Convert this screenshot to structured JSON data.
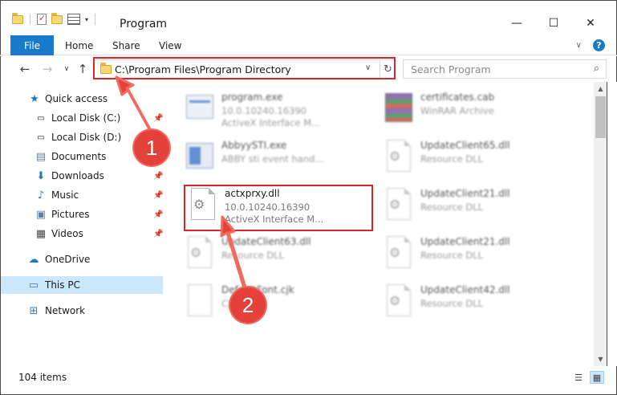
{
  "window": {
    "title": "Program",
    "minimize_glyph": "—",
    "maximize_glyph": "☐",
    "close_glyph": "✕"
  },
  "ribbon": {
    "file_tab": "File",
    "tabs": [
      "Home",
      "Share",
      "View"
    ],
    "help_glyph": "?"
  },
  "address": {
    "path": "C:\\Program Files\\Program Directory",
    "search_placeholder": "Search Program"
  },
  "navpane": {
    "items": [
      {
        "label": "Quick access",
        "icon": "star-icon",
        "pinned": false
      },
      {
        "label": "Local Disk (C:)",
        "icon": "drive-icon",
        "pinned": true
      },
      {
        "label": "Local Disk (D:)",
        "icon": "drive-icon",
        "pinned": true
      },
      {
        "label": "Documents",
        "icon": "documents-icon",
        "pinned": true
      },
      {
        "label": "Downloads",
        "icon": "download-icon",
        "pinned": true
      },
      {
        "label": "Music",
        "icon": "music-icon",
        "pinned": true
      },
      {
        "label": "Pictures",
        "icon": "pictures-icon",
        "pinned": true
      },
      {
        "label": "Videos",
        "icon": "videos-icon",
        "pinned": true
      },
      {
        "label": "OneDrive",
        "icon": "cloud-icon",
        "pinned": false
      },
      {
        "label": "This PC",
        "icon": "pc-icon",
        "pinned": false,
        "selected": true
      },
      {
        "label": "Network",
        "icon": "network-icon",
        "pinned": false
      }
    ]
  },
  "files": [
    {
      "name": "program.exe",
      "sub1": "10.0.10240.16390",
      "sub2": "ActiveX Interface M...",
      "icon": "exe-icon"
    },
    {
      "name": "certificates.cab",
      "sub1": "WinRAR Archive",
      "sub2": "",
      "icon": "archive-icon"
    },
    {
      "name": "AbbyySTI.exe",
      "sub1": "ABBY sti event hand...",
      "sub2": "",
      "icon": "app-icon"
    },
    {
      "name": "UpdateClient65.dll",
      "sub1": "Resource DLL",
      "sub2": "",
      "icon": "dll-icon"
    },
    {
      "name": "actxprxy.dll",
      "sub1": "10.0.10240.16390",
      "sub2": "ActiveX Interface M...",
      "icon": "dll-icon"
    },
    {
      "name": "UpdateClient21.dll",
      "sub1": "Resource DLL",
      "sub2": "",
      "icon": "dll-icon"
    },
    {
      "name": "UpdateClient63.dll",
      "sub1": "Resource DLL",
      "sub2": "",
      "icon": "dll-icon"
    },
    {
      "name": "UpdateClient21.dll",
      "sub1": "Resource DLL",
      "sub2": "",
      "icon": "dll-icon"
    },
    {
      "name": "DefaultFont.cjk",
      "sub1": "CJK File",
      "sub2": "",
      "icon": "document-icon"
    },
    {
      "name": "UpdateClient42.dll",
      "sub1": "Resource DLL",
      "sub2": "",
      "icon": "dll-icon"
    }
  ],
  "status": {
    "items_count": "104 items"
  },
  "callouts": {
    "step1": "1",
    "step2": "2"
  },
  "colors": {
    "accent": "#1979ca",
    "highlight": "#d9252c",
    "callout": "#e3413a",
    "selected": "#cce8ff"
  }
}
